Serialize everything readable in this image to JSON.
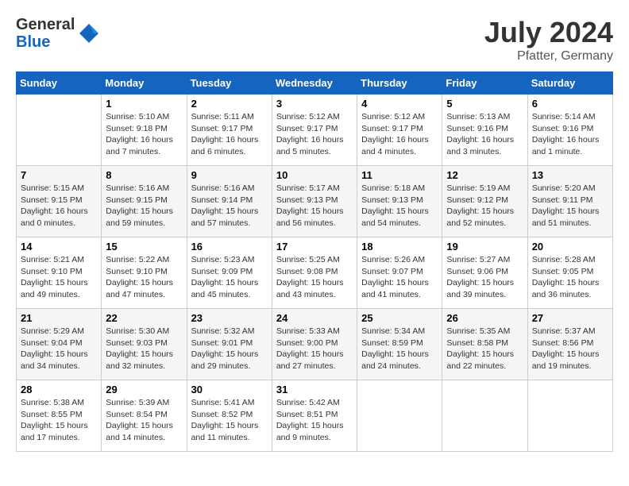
{
  "header": {
    "logo_general": "General",
    "logo_blue": "Blue",
    "month_year": "July 2024",
    "location": "Pfatter, Germany"
  },
  "days_of_week": [
    "Sunday",
    "Monday",
    "Tuesday",
    "Wednesday",
    "Thursday",
    "Friday",
    "Saturday"
  ],
  "weeks": [
    [
      {
        "day": "",
        "info": ""
      },
      {
        "day": "1",
        "info": "Sunrise: 5:10 AM\nSunset: 9:18 PM\nDaylight: 16 hours\nand 7 minutes."
      },
      {
        "day": "2",
        "info": "Sunrise: 5:11 AM\nSunset: 9:17 PM\nDaylight: 16 hours\nand 6 minutes."
      },
      {
        "day": "3",
        "info": "Sunrise: 5:12 AM\nSunset: 9:17 PM\nDaylight: 16 hours\nand 5 minutes."
      },
      {
        "day": "4",
        "info": "Sunrise: 5:12 AM\nSunset: 9:17 PM\nDaylight: 16 hours\nand 4 minutes."
      },
      {
        "day": "5",
        "info": "Sunrise: 5:13 AM\nSunset: 9:16 PM\nDaylight: 16 hours\nand 3 minutes."
      },
      {
        "day": "6",
        "info": "Sunrise: 5:14 AM\nSunset: 9:16 PM\nDaylight: 16 hours\nand 1 minute."
      }
    ],
    [
      {
        "day": "7",
        "info": "Sunrise: 5:15 AM\nSunset: 9:15 PM\nDaylight: 16 hours\nand 0 minutes."
      },
      {
        "day": "8",
        "info": "Sunrise: 5:16 AM\nSunset: 9:15 PM\nDaylight: 15 hours\nand 59 minutes."
      },
      {
        "day": "9",
        "info": "Sunrise: 5:16 AM\nSunset: 9:14 PM\nDaylight: 15 hours\nand 57 minutes."
      },
      {
        "day": "10",
        "info": "Sunrise: 5:17 AM\nSunset: 9:13 PM\nDaylight: 15 hours\nand 56 minutes."
      },
      {
        "day": "11",
        "info": "Sunrise: 5:18 AM\nSunset: 9:13 PM\nDaylight: 15 hours\nand 54 minutes."
      },
      {
        "day": "12",
        "info": "Sunrise: 5:19 AM\nSunset: 9:12 PM\nDaylight: 15 hours\nand 52 minutes."
      },
      {
        "day": "13",
        "info": "Sunrise: 5:20 AM\nSunset: 9:11 PM\nDaylight: 15 hours\nand 51 minutes."
      }
    ],
    [
      {
        "day": "14",
        "info": "Sunrise: 5:21 AM\nSunset: 9:10 PM\nDaylight: 15 hours\nand 49 minutes."
      },
      {
        "day": "15",
        "info": "Sunrise: 5:22 AM\nSunset: 9:10 PM\nDaylight: 15 hours\nand 47 minutes."
      },
      {
        "day": "16",
        "info": "Sunrise: 5:23 AM\nSunset: 9:09 PM\nDaylight: 15 hours\nand 45 minutes."
      },
      {
        "day": "17",
        "info": "Sunrise: 5:25 AM\nSunset: 9:08 PM\nDaylight: 15 hours\nand 43 minutes."
      },
      {
        "day": "18",
        "info": "Sunrise: 5:26 AM\nSunset: 9:07 PM\nDaylight: 15 hours\nand 41 minutes."
      },
      {
        "day": "19",
        "info": "Sunrise: 5:27 AM\nSunset: 9:06 PM\nDaylight: 15 hours\nand 39 minutes."
      },
      {
        "day": "20",
        "info": "Sunrise: 5:28 AM\nSunset: 9:05 PM\nDaylight: 15 hours\nand 36 minutes."
      }
    ],
    [
      {
        "day": "21",
        "info": "Sunrise: 5:29 AM\nSunset: 9:04 PM\nDaylight: 15 hours\nand 34 minutes."
      },
      {
        "day": "22",
        "info": "Sunrise: 5:30 AM\nSunset: 9:03 PM\nDaylight: 15 hours\nand 32 minutes."
      },
      {
        "day": "23",
        "info": "Sunrise: 5:32 AM\nSunset: 9:01 PM\nDaylight: 15 hours\nand 29 minutes."
      },
      {
        "day": "24",
        "info": "Sunrise: 5:33 AM\nSunset: 9:00 PM\nDaylight: 15 hours\nand 27 minutes."
      },
      {
        "day": "25",
        "info": "Sunrise: 5:34 AM\nSunset: 8:59 PM\nDaylight: 15 hours\nand 24 minutes."
      },
      {
        "day": "26",
        "info": "Sunrise: 5:35 AM\nSunset: 8:58 PM\nDaylight: 15 hours\nand 22 minutes."
      },
      {
        "day": "27",
        "info": "Sunrise: 5:37 AM\nSunset: 8:56 PM\nDaylight: 15 hours\nand 19 minutes."
      }
    ],
    [
      {
        "day": "28",
        "info": "Sunrise: 5:38 AM\nSunset: 8:55 PM\nDaylight: 15 hours\nand 17 minutes."
      },
      {
        "day": "29",
        "info": "Sunrise: 5:39 AM\nSunset: 8:54 PM\nDaylight: 15 hours\nand 14 minutes."
      },
      {
        "day": "30",
        "info": "Sunrise: 5:41 AM\nSunset: 8:52 PM\nDaylight: 15 hours\nand 11 minutes."
      },
      {
        "day": "31",
        "info": "Sunrise: 5:42 AM\nSunset: 8:51 PM\nDaylight: 15 hours\nand 9 minutes."
      },
      {
        "day": "",
        "info": ""
      },
      {
        "day": "",
        "info": ""
      },
      {
        "day": "",
        "info": ""
      }
    ]
  ]
}
